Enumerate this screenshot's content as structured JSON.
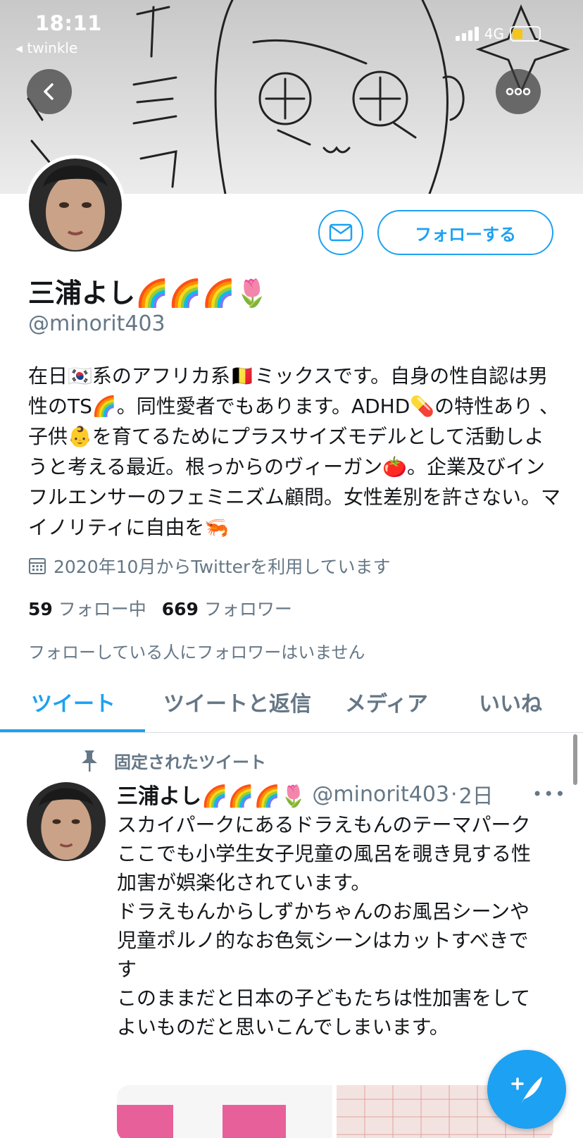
{
  "status_bar": {
    "time": "18:11",
    "back_app": "twinkle",
    "network": "4G"
  },
  "profile": {
    "display_name": "三浦よし🌈🌈🌈🌷",
    "handle": "@minorit403",
    "bio": "在日🇰🇷系のアフリカ系🇧🇪ミックスです。自身の性自認は男性のTS🌈。同性愛者でもあります。ADHD💊の特性あり 、子供👶を育てるためにプラスサイズモデルとして活動しようと考える最近。根っからのヴィーガン🍅。企業及びインフルエンサーのフェミニズム顧問。女性差別を許さない。マイノリティに自由を🦐",
    "joined": "2020年10月からTwitterを利用しています",
    "following_count": "59",
    "following_label": "フォロー中",
    "followers_count": "669",
    "followers_label": "フォロワー",
    "no_mutual_text": "フォローしている人にフォロワーはいません"
  },
  "actions": {
    "follow_label": "フォローする"
  },
  "tabs": [
    {
      "label": "ツイート",
      "active": true
    },
    {
      "label": "ツイートと返信",
      "active": false
    },
    {
      "label": "メディア",
      "active": false
    },
    {
      "label": "いいね",
      "active": false
    }
  ],
  "pinned_tweet": {
    "pinned_label": "固定されたツイート",
    "author_name": "三浦よし🌈🌈🌈🌷",
    "author_handle": "@minorit403",
    "separator": "·",
    "time": "2日",
    "more": "•••",
    "lines": [
      "スカイパークにあるドラえもんのテーマパーク",
      "ここでも小学生女子児童の風呂を覗き見する性加害が娯楽化されています。",
      "ドラえもんからしずかちゃんのお風呂シーンや児童ポルノ的なお色気シーンはカットすべきです",
      "このままだと日本の子どもたちは性加害をしてよいものだと思いこんでしまいます。"
    ]
  },
  "colors": {
    "accent": "#1da1f2",
    "muted": "#657786",
    "text": "#14171a"
  }
}
